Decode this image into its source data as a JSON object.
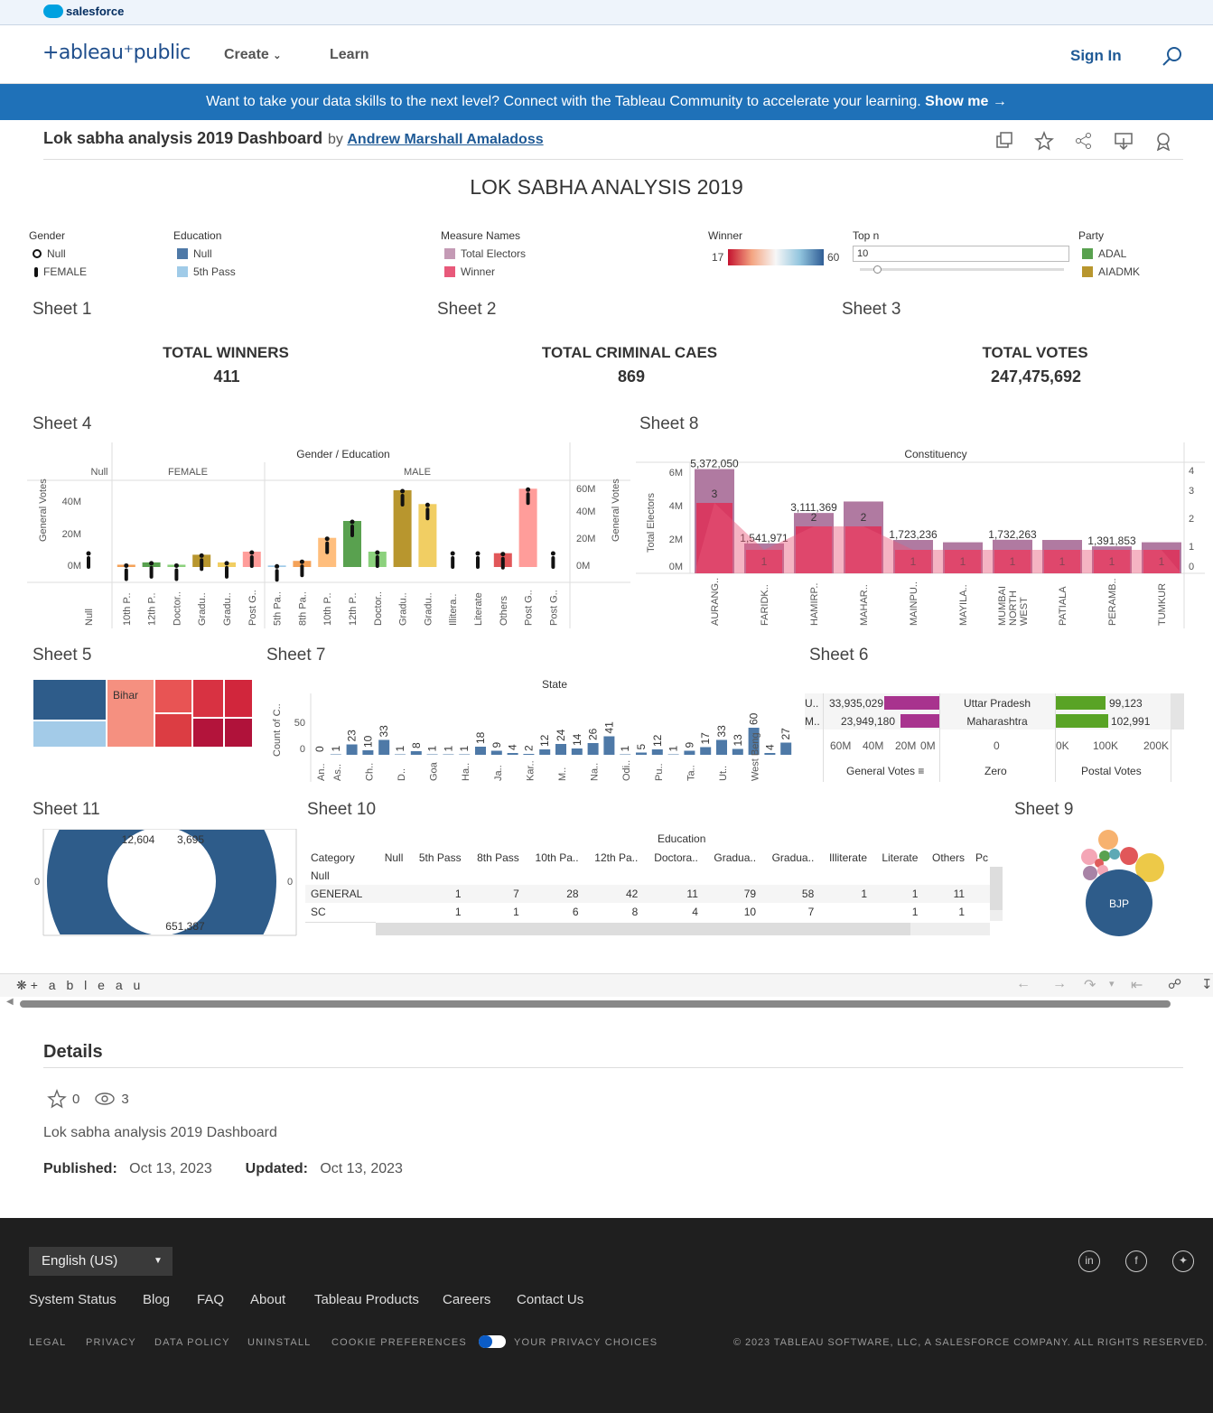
{
  "brand": {
    "salesforce": "salesforce",
    "tableau_public": "+ableau⁺public"
  },
  "nav": {
    "create": "Create",
    "learn": "Learn",
    "sign_in": "Sign In"
  },
  "banner": {
    "text": "Want to take your data skills to the next level? Connect with the Tableau Community to accelerate your learning.",
    "cta": "Show me →"
  },
  "viz": {
    "title": "Lok sabha analysis 2019 Dashboard",
    "by": "by",
    "author": "Andrew Marshall Amaladoss"
  },
  "dashboard": {
    "title": "LOK SABHA ANALYSIS 2019",
    "legends": {
      "gender": {
        "title": "Gender",
        "items": [
          "Null",
          "FEMALE"
        ]
      },
      "education": {
        "title": "Education",
        "items": [
          "Null",
          "5th Pass"
        ],
        "colors": [
          "#4e79a7",
          "#a0cbe8"
        ]
      },
      "measure_names": {
        "title": "Measure Names",
        "items": [
          "Total Electors",
          "Winner"
        ],
        "colors": [
          "#b07aa1",
          "#e8597a"
        ]
      },
      "winner": {
        "title": "Winner",
        "min": "17",
        "max": "60"
      },
      "top_n": {
        "title": "Top n",
        "value": "10"
      },
      "party": {
        "title": "Party",
        "items": [
          "ADAL",
          "AIADMK"
        ],
        "colors": [
          "#59a14f",
          "#b8962e"
        ]
      }
    },
    "sheets": {
      "s1": "Sheet 1",
      "s2": "Sheet 2",
      "s3": "Sheet 3",
      "s4": "Sheet 4",
      "s5": "Sheet 5",
      "s6": "Sheet 6",
      "s7": "Sheet 7",
      "s8": "Sheet 8",
      "s9": "Sheet 9",
      "s10": "Sheet 10",
      "s11": "Sheet 11"
    },
    "kpis": [
      {
        "label": "TOTAL WINNERS",
        "value": "411"
      },
      {
        "label": "TOTAL CRIMINAL CAES",
        "value": "869"
      },
      {
        "label": "TOTAL VOTES",
        "value": "247,475,692"
      }
    ],
    "sheet4": {
      "title": "Gender / Education",
      "groups": [
        "Null",
        "FEMALE",
        "MALE"
      ],
      "ylabel": "General Votes",
      "left_ticks": [
        "40M",
        "20M",
        "0M"
      ],
      "right_ticks": [
        "60M",
        "40M",
        "20M",
        "0M"
      ],
      "categories": [
        "Null",
        "10th P..",
        "12th P..",
        "Doctor..",
        "Gradu..",
        "Gradu..",
        "Post G..",
        "5th Pa..",
        "8th Pa..",
        "10th P..",
        "12th P..",
        "Doctor..",
        "Gradu..",
        "Gradu..",
        "Illitera..",
        "Literate",
        "Others",
        "Post G..",
        "Post G.."
      ],
      "values_m": [
        0,
        1.5,
        3,
        1.5,
        8,
        3,
        10,
        1,
        4,
        19,
        30,
        10,
        50,
        41,
        0,
        0,
        9,
        51,
        0
      ],
      "colors": [
        "#ffffff",
        "#f4a259",
        "#59a14f",
        "#8cd17d",
        "#b8962e",
        "#f1ce63",
        "#ff9d9a",
        "#a0cbe8",
        "#f4a259",
        "#ffbe7d",
        "#59a14f",
        "#8cd17d",
        "#b8962e",
        "#f1ce63",
        "#ffffff",
        "#ffffff",
        "#e15759",
        "#ff9d9a",
        "#ffffff"
      ]
    },
    "sheet8": {
      "title": "Constituency",
      "ylabel": "Total Electors",
      "left_ticks": [
        "6M",
        "4M",
        "2M",
        "0M"
      ],
      "right_ticks": [
        "4",
        "3",
        "2",
        "1",
        "0"
      ],
      "categories": [
        "AURANG..",
        "FARIDK..",
        "HAMIRP..",
        "MAHAR..",
        "MAINPU..",
        "MAYILA..",
        "MUMBAI NORTH WEST",
        "PATIALA",
        "PERAMB..",
        "TUMKUR"
      ],
      "electors": [
        5.37,
        1.54,
        3.11,
        3.7,
        1.72,
        1.6,
        1.73,
        1.72,
        1.39,
        1.6
      ],
      "winners": [
        3,
        1,
        2,
        2,
        1,
        1,
        1,
        1,
        1,
        1
      ],
      "labels": [
        "5,372,050",
        "1,541,971",
        "3,111,369",
        "",
        "1,723,236",
        "",
        "1,732,263",
        "",
        "1,391,853",
        ""
      ],
      "winner_labels": [
        "3",
        "1",
        "2",
        "2",
        "1",
        "1",
        "1",
        "1",
        "1",
        "1"
      ]
    },
    "sheet5": {
      "label": "Bihar"
    },
    "sheet7": {
      "title": "State",
      "ylabel": "Count of C..",
      "ticks": [
        "50",
        "0"
      ],
      "categories": [
        "An..",
        "As..",
        "",
        "Ch..",
        "",
        "D..",
        "",
        "Goa",
        "",
        "Ha..",
        "",
        "Ja..",
        "",
        "Kar..",
        "",
        "M..",
        "",
        "Na..",
        "",
        "Odi..",
        "",
        "Pu..",
        "",
        "Ta..",
        "",
        "Ut..",
        "",
        "West Beng"
      ],
      "values": [
        0,
        1,
        23,
        10,
        33,
        1,
        8,
        1,
        1,
        1,
        18,
        9,
        4,
        2,
        12,
        24,
        14,
        26,
        41,
        1,
        5,
        12,
        1,
        9,
        17,
        33,
        13,
        60,
        4,
        27
      ]
    },
    "sheet6": {
      "rows": [
        {
          "abbr": "U..",
          "general": "33,935,029",
          "state": "Uttar Pradesh",
          "postal": "99,123"
        },
        {
          "abbr": "M..",
          "general": "23,949,180",
          "state": "Maharashtra",
          "postal": "102,991"
        }
      ],
      "general_ticks": [
        "60M",
        "40M",
        "20M",
        "0M"
      ],
      "zero_ticks": [
        "0"
      ],
      "postal_ticks": [
        "0K",
        "100K",
        "200K"
      ],
      "headers": [
        "General Votes",
        "Zero",
        "Postal Votes"
      ]
    },
    "sheet11": {
      "labels": [
        "12,604",
        "3,695",
        "651,387"
      ],
      "axis": [
        "0",
        "0"
      ]
    },
    "sheet10": {
      "title": "Education",
      "headers": [
        "Category",
        "Null",
        "5th Pass",
        "8th Pass",
        "10th Pa..",
        "12th Pa..",
        "Doctora..",
        "Gradua..",
        "Gradua..",
        "Illiterate",
        "Literate",
        "Others",
        "Pc"
      ],
      "rows": [
        [
          "Null",
          "",
          "",
          "",
          "",
          "",
          "",
          "",
          "",
          "",
          "",
          "",
          ""
        ],
        [
          "GENERAL",
          "",
          "1",
          "7",
          "28",
          "42",
          "11",
          "79",
          "58",
          "1",
          "1",
          "11",
          ""
        ],
        [
          "SC",
          "",
          "1",
          "1",
          "6",
          "8",
          "4",
          "10",
          "7",
          "",
          "1",
          "1",
          ""
        ]
      ]
    },
    "sheet9": {
      "label": "BJP"
    }
  },
  "toolbar": {
    "logo": "+ a b l e a u"
  },
  "details": {
    "heading": "Details",
    "favorites": "0",
    "views": "3",
    "description": "Lok sabha analysis 2019 Dashboard",
    "published_label": "Published:",
    "published": "Oct 13, 2023",
    "updated_label": "Updated:",
    "updated": "Oct 13, 2023"
  },
  "footer": {
    "language": "English (US)",
    "links": [
      "System Status",
      "Blog",
      "FAQ",
      "About",
      "Tableau Products",
      "Careers",
      "Contact Us"
    ],
    "legal": [
      "LEGAL",
      "PRIVACY",
      "DATA POLICY",
      "UNINSTALL",
      "COOKIE PREFERENCES",
      "YOUR PRIVACY CHOICES"
    ],
    "copyright": "© 2023 TABLEAU SOFTWARE, LLC, A SALESFORCE COMPANY. ALL RIGHTS RESERVED."
  }
}
